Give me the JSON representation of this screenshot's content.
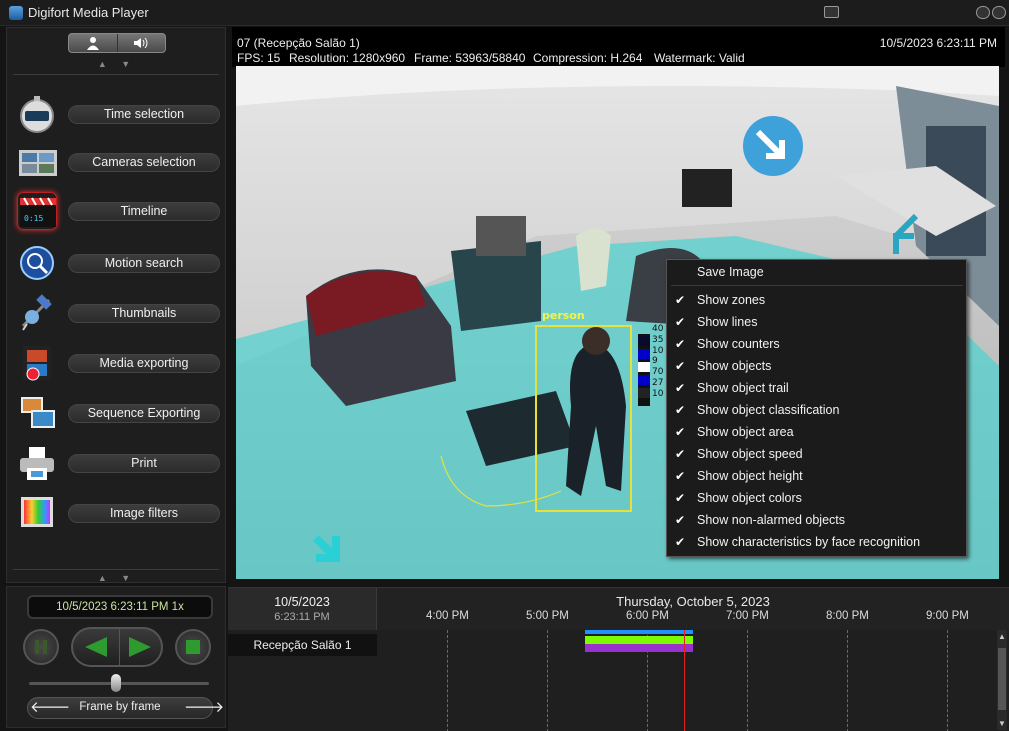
{
  "window": {
    "title": "Digifort Media Player"
  },
  "sidebar": {
    "toggle": {
      "left_icon": "person-icon",
      "right_icon": "speaker-icon"
    },
    "scroll_arrows": "▲ ▼",
    "items": [
      {
        "label": "Time selection",
        "icon": "stopwatch-icon"
      },
      {
        "label": "Cameras selection",
        "icon": "cameras-icon"
      },
      {
        "label": "Timeline",
        "icon": "clapperboard-icon"
      },
      {
        "label": "Motion search",
        "icon": "motion-search-icon"
      },
      {
        "label": "Thumbnails",
        "icon": "satellite-icon"
      },
      {
        "label": "Media exporting",
        "icon": "film-icon"
      },
      {
        "label": "Sequence Exporting",
        "icon": "photos-icon"
      },
      {
        "label": "Print",
        "icon": "printer-icon"
      },
      {
        "label": "Image filters",
        "icon": "color-palette-icon"
      }
    ]
  },
  "playback": {
    "datetime_display": "10/5/2023 6:23:11 PM 1x",
    "mode_label": "Frame by frame",
    "prev_arrow": "🡐",
    "next_arrow": "🡒"
  },
  "video": {
    "camera": "07 (Recepção Salão 1)",
    "timestamp": "10/5/2023 6:23:11 PM",
    "fps": "FPS: 15",
    "resolution": "Resolution: 1280x960",
    "frame": "Frame: 53963/58840",
    "compression": "Compression: H.264",
    "watermark": "Watermark: Valid",
    "detection_label": "person",
    "color_bars": [
      "40",
      "35",
      "10",
      "9",
      "70",
      "27",
      "10"
    ]
  },
  "context_menu": {
    "items": [
      {
        "label": "Save Image",
        "checked": false
      },
      {
        "label": "Show zones",
        "checked": true
      },
      {
        "label": "Show lines",
        "checked": true
      },
      {
        "label": "Show counters",
        "checked": true
      },
      {
        "label": "Show objects",
        "checked": true
      },
      {
        "label": "Show object trail",
        "checked": true
      },
      {
        "label": "Show object classification",
        "checked": true
      },
      {
        "label": "Show object area",
        "checked": true
      },
      {
        "label": "Show object speed",
        "checked": true
      },
      {
        "label": "Show object height",
        "checked": true
      },
      {
        "label": "Show object colors",
        "checked": true
      },
      {
        "label": "Show non-alarmed objects",
        "checked": true
      },
      {
        "label": "Show characteristics by face recognition",
        "checked": true
      }
    ],
    "check_glyph": "✔"
  },
  "timeline": {
    "date": "10/5/2023",
    "time": "6:23:11 PM",
    "day_title": "Thursday, October 5, 2023",
    "hours": [
      "4:00 PM",
      "5:00 PM",
      "6:00 PM",
      "7:00 PM",
      "8:00 PM",
      "9:00 PM"
    ],
    "camera_row": "Recepção Salão 1",
    "recording_colors": [
      "#1e90ff",
      "#7cfc00",
      "#9932cc"
    ],
    "cursor_color": "#e02020"
  }
}
